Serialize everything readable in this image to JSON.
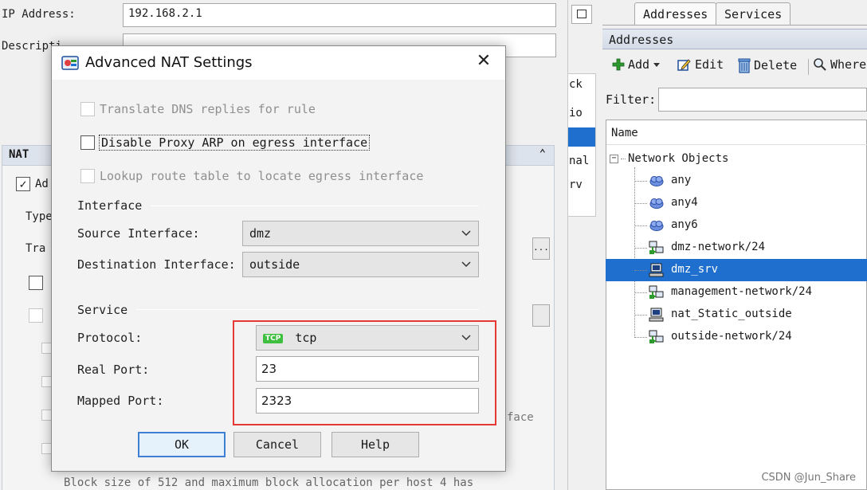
{
  "background_form": {
    "ip_label": "IP Address:",
    "ip_value": "192.168.2.1",
    "description_label": "Descripti",
    "nat_section_title": "NAT",
    "nat_collapse_glyph": "⌃",
    "auto_nat_fragment": "Ad",
    "type_fragment": "Type",
    "translated_fragment": "Tra",
    "ellipsis": "...",
    "bottom_text": "Block size of 512 and maximum block allocation per host 4 has",
    "side_text_fragment": "face"
  },
  "mid_strip": {
    "fragments": [
      "ck",
      "io",
      "nal",
      "rv"
    ]
  },
  "right_panel": {
    "tabs": [
      {
        "label": "Addresses",
        "active": true
      },
      {
        "label": "Services",
        "active": false
      }
    ],
    "title": "Addresses",
    "toolbar": {
      "add": "Add",
      "edit": "Edit",
      "delete": "Delete",
      "where": "Where"
    },
    "filter_label": "Filter:",
    "column_header": "Name",
    "tree_root": "Network Objects",
    "items": [
      {
        "label": "any",
        "icon": "cloud-icon",
        "selected": false
      },
      {
        "label": "any4",
        "icon": "cloud-icon",
        "selected": false
      },
      {
        "label": "any6",
        "icon": "cloud-icon",
        "selected": false
      },
      {
        "label": "dmz-network/24",
        "icon": "network-icon",
        "selected": false
      },
      {
        "label": "dmz_srv",
        "icon": "host-icon",
        "selected": true
      },
      {
        "label": "management-network/24",
        "icon": "network-icon",
        "selected": false
      },
      {
        "label": "nat_Static_outside",
        "icon": "host-icon",
        "selected": false
      },
      {
        "label": "outside-network/24",
        "icon": "network-icon",
        "selected": false
      }
    ]
  },
  "dialog": {
    "title": "Advanced NAT Settings",
    "options": [
      {
        "label": "Translate DNS replies for rule",
        "enabled": false,
        "checked": false
      },
      {
        "label": "Disable Proxy ARP on egress interface",
        "enabled": true,
        "checked": false
      },
      {
        "label": "Lookup route table to locate egress interface",
        "enabled": false,
        "checked": false
      }
    ],
    "interface_section": "Interface",
    "source_interface_label": "Source Interface:",
    "source_interface_value": "dmz",
    "destination_interface_label": "Destination Interface:",
    "destination_interface_value": "outside",
    "service_section": "Service",
    "protocol_label": "Protocol:",
    "protocol_badge": "TCP",
    "protocol_value": "tcp",
    "real_port_label": "Real Port:",
    "real_port_value": "23",
    "mapped_port_label": "Mapped Port:",
    "mapped_port_value": "2323",
    "ok_label": "OK",
    "cancel_label": "Cancel",
    "help_label": "Help",
    "close_glyph": "✕"
  },
  "watermark": "CSDN @Jun_Share",
  "colors": {
    "selection": "#1e6fce",
    "highlight_box": "#e53935",
    "default_button_border": "#3f7fd6"
  }
}
